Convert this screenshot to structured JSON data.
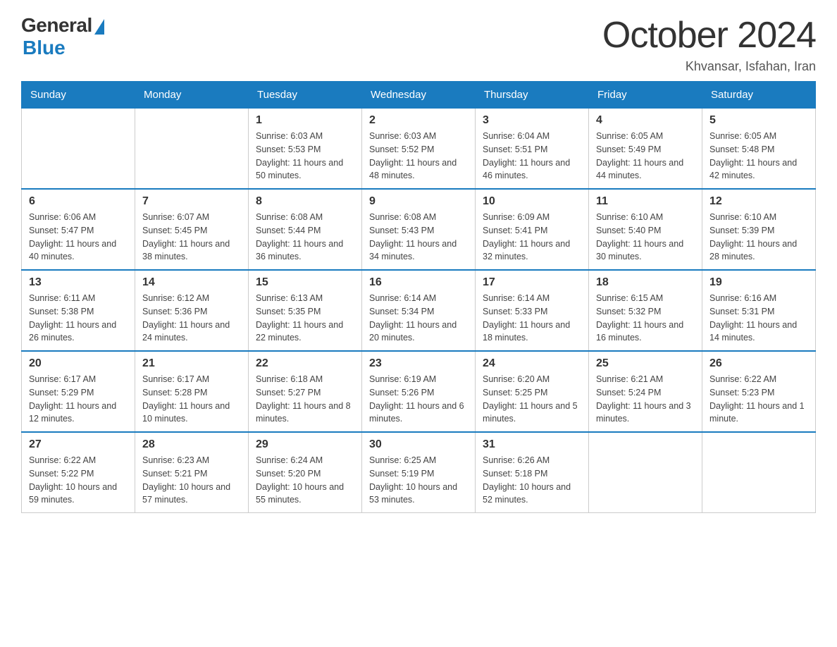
{
  "logo": {
    "general": "General",
    "blue": "Blue",
    "subtitle": "Blue"
  },
  "header": {
    "title": "October 2024",
    "location": "Khvansar, Isfahan, Iran"
  },
  "weekdays": [
    "Sunday",
    "Monday",
    "Tuesday",
    "Wednesday",
    "Thursday",
    "Friday",
    "Saturday"
  ],
  "weeks": [
    [
      {
        "day": "",
        "sunrise": "",
        "sunset": "",
        "daylight": ""
      },
      {
        "day": "",
        "sunrise": "",
        "sunset": "",
        "daylight": ""
      },
      {
        "day": "1",
        "sunrise": "Sunrise: 6:03 AM",
        "sunset": "Sunset: 5:53 PM",
        "daylight": "Daylight: 11 hours and 50 minutes."
      },
      {
        "day": "2",
        "sunrise": "Sunrise: 6:03 AM",
        "sunset": "Sunset: 5:52 PM",
        "daylight": "Daylight: 11 hours and 48 minutes."
      },
      {
        "day": "3",
        "sunrise": "Sunrise: 6:04 AM",
        "sunset": "Sunset: 5:51 PM",
        "daylight": "Daylight: 11 hours and 46 minutes."
      },
      {
        "day": "4",
        "sunrise": "Sunrise: 6:05 AM",
        "sunset": "Sunset: 5:49 PM",
        "daylight": "Daylight: 11 hours and 44 minutes."
      },
      {
        "day": "5",
        "sunrise": "Sunrise: 6:05 AM",
        "sunset": "Sunset: 5:48 PM",
        "daylight": "Daylight: 11 hours and 42 minutes."
      }
    ],
    [
      {
        "day": "6",
        "sunrise": "Sunrise: 6:06 AM",
        "sunset": "Sunset: 5:47 PM",
        "daylight": "Daylight: 11 hours and 40 minutes."
      },
      {
        "day": "7",
        "sunrise": "Sunrise: 6:07 AM",
        "sunset": "Sunset: 5:45 PM",
        "daylight": "Daylight: 11 hours and 38 minutes."
      },
      {
        "day": "8",
        "sunrise": "Sunrise: 6:08 AM",
        "sunset": "Sunset: 5:44 PM",
        "daylight": "Daylight: 11 hours and 36 minutes."
      },
      {
        "day": "9",
        "sunrise": "Sunrise: 6:08 AM",
        "sunset": "Sunset: 5:43 PM",
        "daylight": "Daylight: 11 hours and 34 minutes."
      },
      {
        "day": "10",
        "sunrise": "Sunrise: 6:09 AM",
        "sunset": "Sunset: 5:41 PM",
        "daylight": "Daylight: 11 hours and 32 minutes."
      },
      {
        "day": "11",
        "sunrise": "Sunrise: 6:10 AM",
        "sunset": "Sunset: 5:40 PM",
        "daylight": "Daylight: 11 hours and 30 minutes."
      },
      {
        "day": "12",
        "sunrise": "Sunrise: 6:10 AM",
        "sunset": "Sunset: 5:39 PM",
        "daylight": "Daylight: 11 hours and 28 minutes."
      }
    ],
    [
      {
        "day": "13",
        "sunrise": "Sunrise: 6:11 AM",
        "sunset": "Sunset: 5:38 PM",
        "daylight": "Daylight: 11 hours and 26 minutes."
      },
      {
        "day": "14",
        "sunrise": "Sunrise: 6:12 AM",
        "sunset": "Sunset: 5:36 PM",
        "daylight": "Daylight: 11 hours and 24 minutes."
      },
      {
        "day": "15",
        "sunrise": "Sunrise: 6:13 AM",
        "sunset": "Sunset: 5:35 PM",
        "daylight": "Daylight: 11 hours and 22 minutes."
      },
      {
        "day": "16",
        "sunrise": "Sunrise: 6:14 AM",
        "sunset": "Sunset: 5:34 PM",
        "daylight": "Daylight: 11 hours and 20 minutes."
      },
      {
        "day": "17",
        "sunrise": "Sunrise: 6:14 AM",
        "sunset": "Sunset: 5:33 PM",
        "daylight": "Daylight: 11 hours and 18 minutes."
      },
      {
        "day": "18",
        "sunrise": "Sunrise: 6:15 AM",
        "sunset": "Sunset: 5:32 PM",
        "daylight": "Daylight: 11 hours and 16 minutes."
      },
      {
        "day": "19",
        "sunrise": "Sunrise: 6:16 AM",
        "sunset": "Sunset: 5:31 PM",
        "daylight": "Daylight: 11 hours and 14 minutes."
      }
    ],
    [
      {
        "day": "20",
        "sunrise": "Sunrise: 6:17 AM",
        "sunset": "Sunset: 5:29 PM",
        "daylight": "Daylight: 11 hours and 12 minutes."
      },
      {
        "day": "21",
        "sunrise": "Sunrise: 6:17 AM",
        "sunset": "Sunset: 5:28 PM",
        "daylight": "Daylight: 11 hours and 10 minutes."
      },
      {
        "day": "22",
        "sunrise": "Sunrise: 6:18 AM",
        "sunset": "Sunset: 5:27 PM",
        "daylight": "Daylight: 11 hours and 8 minutes."
      },
      {
        "day": "23",
        "sunrise": "Sunrise: 6:19 AM",
        "sunset": "Sunset: 5:26 PM",
        "daylight": "Daylight: 11 hours and 6 minutes."
      },
      {
        "day": "24",
        "sunrise": "Sunrise: 6:20 AM",
        "sunset": "Sunset: 5:25 PM",
        "daylight": "Daylight: 11 hours and 5 minutes."
      },
      {
        "day": "25",
        "sunrise": "Sunrise: 6:21 AM",
        "sunset": "Sunset: 5:24 PM",
        "daylight": "Daylight: 11 hours and 3 minutes."
      },
      {
        "day": "26",
        "sunrise": "Sunrise: 6:22 AM",
        "sunset": "Sunset: 5:23 PM",
        "daylight": "Daylight: 11 hours and 1 minute."
      }
    ],
    [
      {
        "day": "27",
        "sunrise": "Sunrise: 6:22 AM",
        "sunset": "Sunset: 5:22 PM",
        "daylight": "Daylight: 10 hours and 59 minutes."
      },
      {
        "day": "28",
        "sunrise": "Sunrise: 6:23 AM",
        "sunset": "Sunset: 5:21 PM",
        "daylight": "Daylight: 10 hours and 57 minutes."
      },
      {
        "day": "29",
        "sunrise": "Sunrise: 6:24 AM",
        "sunset": "Sunset: 5:20 PM",
        "daylight": "Daylight: 10 hours and 55 minutes."
      },
      {
        "day": "30",
        "sunrise": "Sunrise: 6:25 AM",
        "sunset": "Sunset: 5:19 PM",
        "daylight": "Daylight: 10 hours and 53 minutes."
      },
      {
        "day": "31",
        "sunrise": "Sunrise: 6:26 AM",
        "sunset": "Sunset: 5:18 PM",
        "daylight": "Daylight: 10 hours and 52 minutes."
      },
      {
        "day": "",
        "sunrise": "",
        "sunset": "",
        "daylight": ""
      },
      {
        "day": "",
        "sunrise": "",
        "sunset": "",
        "daylight": ""
      }
    ]
  ]
}
